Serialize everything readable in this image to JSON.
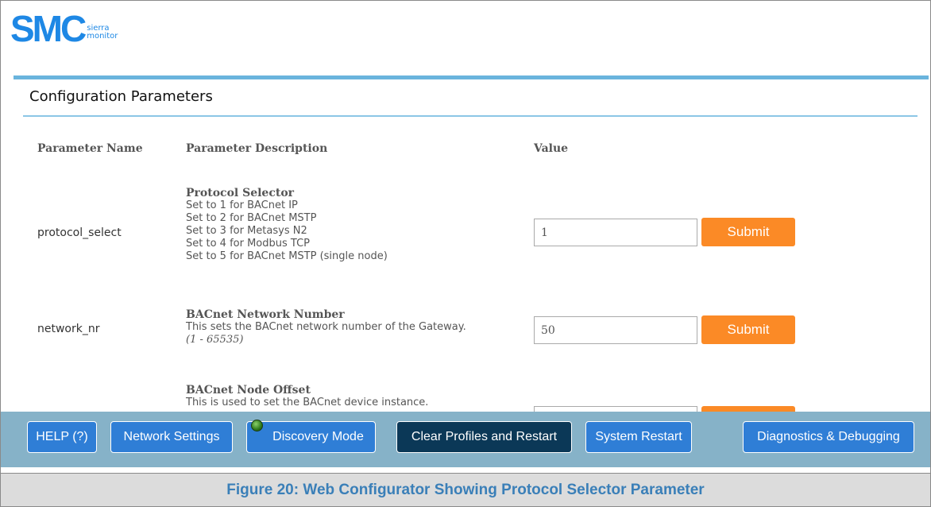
{
  "logo": {
    "mark": "SMC",
    "sub_line1": "sierra",
    "sub_line2": "monitor"
  },
  "page_title": "Configuration Parameters",
  "columns": {
    "name": "Parameter Name",
    "description": "Parameter Description",
    "value": "Value"
  },
  "params": [
    {
      "name": "protocol_select",
      "title": "Protocol Selector",
      "lines": [
        "Set to 1 for BACnet IP",
        "Set to 2 for BACnet MSTP",
        "Set to 3 for Metasys N2",
        "Set to 4 for Modbus TCP",
        "Set to 5 for BACnet MSTP (single node)"
      ],
      "value": "1",
      "submit_label": "Submit"
    },
    {
      "name": "network_nr",
      "title": "BACnet Network Number",
      "lines": [
        "This sets the BACnet network number of the Gateway."
      ],
      "range": "(1 - 65535)",
      "value": "50",
      "submit_label": "Submit"
    },
    {
      "title": "BACnet Node Offset",
      "lines": [
        "This is used to set the BACnet device instance."
      ]
    }
  ],
  "footer_buttons": {
    "help": "HELP (?)",
    "network_settings": "Network Settings",
    "discovery_mode": "Discovery Mode",
    "clear_profiles": "Clear Profiles and Restart",
    "system_restart": "System Restart",
    "diagnostics": "Diagnostics & Debugging"
  },
  "caption": "Figure 20: Web Configurator Showing Protocol Selector Parameter",
  "colors": {
    "accent_blue": "#2f7ed6",
    "submit_orange": "#fb8a26",
    "footer_bar": "#86b2c8",
    "dark_button": "#0b3857"
  }
}
